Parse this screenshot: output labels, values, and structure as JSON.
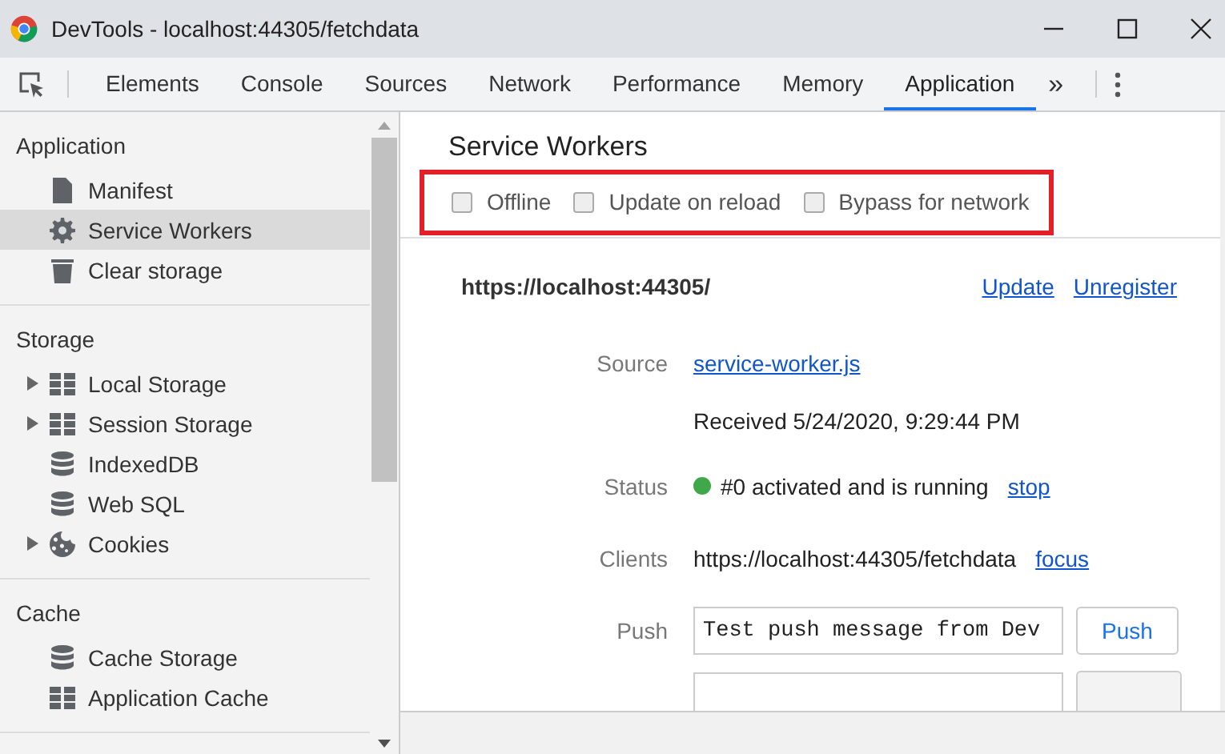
{
  "window": {
    "title": "DevTools - localhost:44305/fetchdata"
  },
  "toolbar": {
    "tabs": [
      {
        "label": "Elements",
        "selected": false
      },
      {
        "label": "Console",
        "selected": false
      },
      {
        "label": "Sources",
        "selected": false
      },
      {
        "label": "Network",
        "selected": false
      },
      {
        "label": "Performance",
        "selected": false
      },
      {
        "label": "Memory",
        "selected": false
      },
      {
        "label": "Application",
        "selected": true
      }
    ],
    "more": "»"
  },
  "sidebar": {
    "sections": [
      {
        "title": "Application",
        "items": [
          {
            "label": "Manifest",
            "kind": "file",
            "expandable": false,
            "selected": false
          },
          {
            "label": "Service Workers",
            "kind": "gear",
            "expandable": false,
            "selected": true
          },
          {
            "label": "Clear storage",
            "kind": "trash",
            "expandable": false,
            "selected": false
          }
        ]
      },
      {
        "title": "Storage",
        "items": [
          {
            "label": "Local Storage",
            "kind": "grid",
            "expandable": true,
            "selected": false
          },
          {
            "label": "Session Storage",
            "kind": "grid",
            "expandable": true,
            "selected": false
          },
          {
            "label": "IndexedDB",
            "kind": "database",
            "expandable": false,
            "selected": false
          },
          {
            "label": "Web SQL",
            "kind": "database",
            "expandable": false,
            "selected": false
          },
          {
            "label": "Cookies",
            "kind": "cookie",
            "expandable": true,
            "selected": false
          }
        ]
      },
      {
        "title": "Cache",
        "items": [
          {
            "label": "Cache Storage",
            "kind": "database",
            "expandable": false,
            "selected": false
          },
          {
            "label": "Application Cache",
            "kind": "grid",
            "expandable": false,
            "selected": false
          }
        ]
      }
    ]
  },
  "main": {
    "title": "Service Workers",
    "options_highlighted": true,
    "options": [
      {
        "label": "Offline",
        "checked": false
      },
      {
        "label": "Update on reload",
        "checked": false
      },
      {
        "label": "Bypass for network",
        "checked": false
      }
    ],
    "registration": {
      "scope": "https://localhost:44305/",
      "actions": [
        "Update",
        "Unregister"
      ],
      "rows": [
        {
          "kind": "link",
          "label": "Source",
          "value": "service-worker.js"
        },
        {
          "kind": "text",
          "value": "Received 5/24/2020, 9:29:44 PM"
        },
        {
          "kind": "status",
          "label": "Status",
          "color": "#3ea84a",
          "value": "#0 activated and is running",
          "action": "stop"
        },
        {
          "kind": "clients",
          "label": "Clients",
          "value": "https://localhost:44305/fetchdata",
          "action": "focus"
        },
        {
          "kind": "input",
          "label": "Push",
          "value": "Test push message from Dev",
          "button": "Push"
        },
        {
          "kind": "cut_input"
        }
      ]
    }
  }
}
